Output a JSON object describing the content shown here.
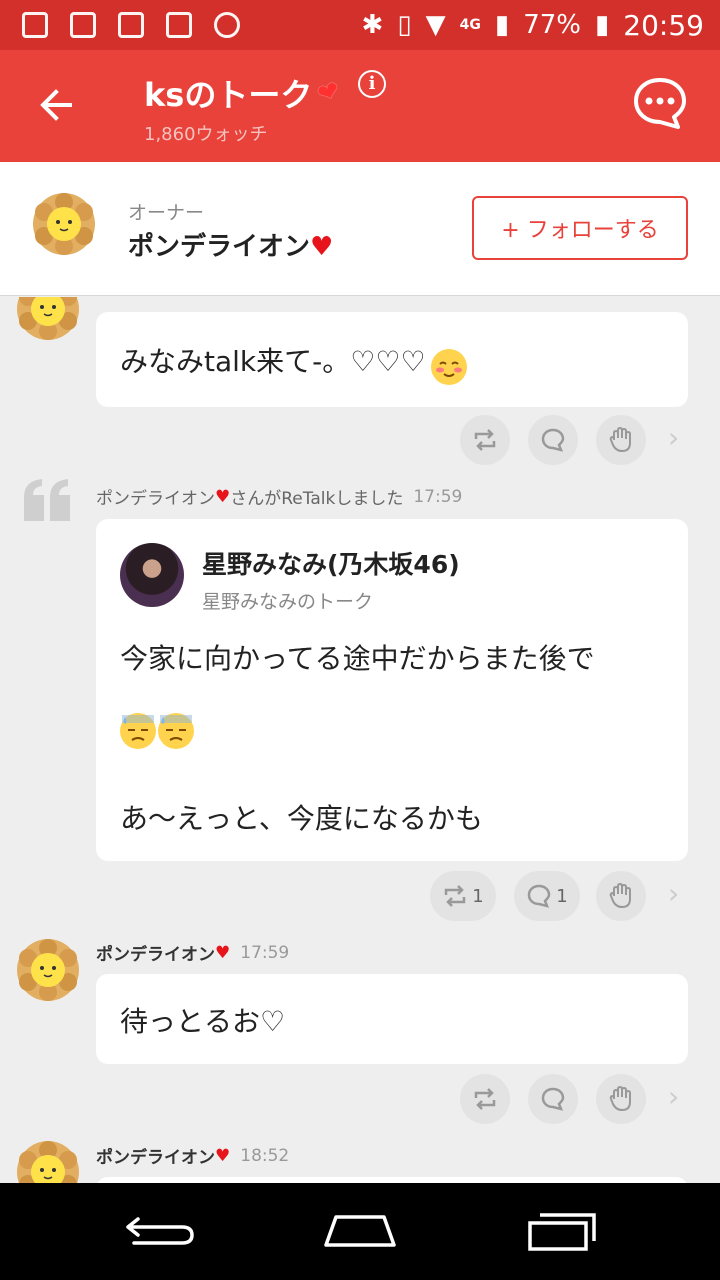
{
  "status_bar": {
    "network": "4G",
    "battery": "77%",
    "time": "20:59"
  },
  "app_bar": {
    "title": "ksのトーク",
    "watch_count": "1,860ウォッチ"
  },
  "owner": {
    "label": "オーナー",
    "name": "ポンデライオン",
    "follow_label": "+ フォローする"
  },
  "feed": {
    "post1": {
      "text": "みなみtalk来て-。♡♡♡"
    },
    "retalk": {
      "meta_prefix": "ポンデライオン",
      "meta_suffix": "さんがReTalkしました",
      "time": "17:59",
      "user_name": "星野みなみ(乃木坂46)",
      "talk_name": "星野みなみのトーク",
      "line1": "今家に向かってる途中だからまた後で",
      "line3": "あ〜えっと、今度になるかも",
      "retalk_count": "1",
      "comment_count": "1"
    },
    "post2": {
      "name": "ポンデライオン",
      "time": "17:59",
      "text": "待っとるお♡"
    },
    "post3": {
      "name": "ポンデライオン",
      "time": "18:52"
    }
  },
  "icons": {
    "accent_color": "#e8423b",
    "heart_color": "#e8141c"
  }
}
